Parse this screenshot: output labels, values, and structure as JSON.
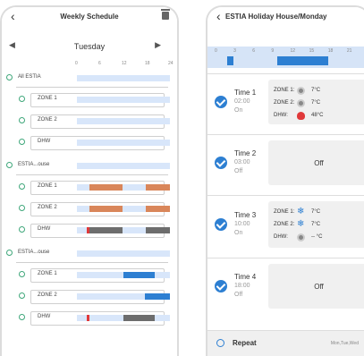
{
  "left": {
    "title": "Weekly Schedule",
    "day": "Tuesday",
    "ticks": [
      "0",
      "6",
      "12",
      "18",
      "24"
    ],
    "colors": {
      "orange": "#d9865a",
      "blue": "#2d7fd2",
      "gray": "#6d6d6d",
      "red": "#e0393a",
      "light": "#d8e6fa",
      "green": "#3fa77a"
    },
    "groups": [
      {
        "label": "All ESTIA",
        "rows": [
          {
            "label": "ZONE 1",
            "segments": []
          },
          {
            "label": "ZONE 2",
            "segments": []
          },
          {
            "label": "DHW",
            "segments": []
          }
        ]
      },
      {
        "label": "ESTIA...ouse",
        "rows": [
          {
            "label": "ZONE 1",
            "segments": [
              {
                "start": 3.2,
                "end": 11.8,
                "color": "orange"
              },
              {
                "start": 17.8,
                "end": 24,
                "color": "orange"
              }
            ]
          },
          {
            "label": "ZONE 2",
            "segments": [
              {
                "start": 3.2,
                "end": 11.8,
                "color": "orange"
              },
              {
                "start": 17.8,
                "end": 24,
                "color": "orange"
              }
            ]
          },
          {
            "label": "DHW",
            "segments": [
              {
                "start": 2.5,
                "end": 3.2,
                "color": "red"
              },
              {
                "start": 3.2,
                "end": 11.8,
                "color": "gray"
              },
              {
                "start": 17.8,
                "end": 24,
                "color": "gray"
              }
            ]
          }
        ]
      },
      {
        "label": "ESTIA...ouse",
        "rows": [
          {
            "label": "ZONE 1",
            "segments": [
              {
                "start": 12,
                "end": 20,
                "color": "blue"
              }
            ]
          },
          {
            "label": "ZONE 2",
            "segments": [
              {
                "start": 17.5,
                "end": 24,
                "color": "blue"
              }
            ]
          },
          {
            "label": "DHW",
            "segments": [
              {
                "start": 2.5,
                "end": 3.2,
                "color": "red"
              },
              {
                "start": 3.2,
                "end": 6,
                "color": "light"
              },
              {
                "start": 12,
                "end": 20,
                "color": "gray"
              }
            ]
          }
        ]
      }
    ]
  },
  "right": {
    "title": "ESTIA Holiday House/Monday",
    "ticks": [
      "0",
      "3",
      "6",
      "9",
      "12",
      "15",
      "18",
      "21"
    ],
    "strip": {
      "blocks": [
        {
          "start": 2,
          "end": 3,
          "color": "blue"
        },
        {
          "start": 10,
          "end": 18,
          "color": "blue"
        }
      ]
    },
    "times": [
      {
        "label": "Time 1",
        "time": "02:00",
        "state": "On",
        "details": [
          {
            "name": "ZONE 1:",
            "icon": "gray-circle-icon",
            "value": "7°C"
          },
          {
            "name": "ZONE 2:",
            "icon": "gray-circle-icon",
            "value": "7°C"
          },
          {
            "name": "DHW:",
            "icon": "flame-icon",
            "value": "48°C"
          }
        ]
      },
      {
        "label": "Time 2",
        "time": "03:00",
        "state": "Off",
        "off_text": "Off"
      },
      {
        "label": "Time 3",
        "time": "10:00",
        "state": "On",
        "details": [
          {
            "name": "ZONE 1:",
            "icon": "snowflake-icon",
            "value": "7°C"
          },
          {
            "name": "ZONE 2:",
            "icon": "snowflake-icon",
            "value": "7°C"
          },
          {
            "name": "DHW:",
            "icon": "gray-circle-icon",
            "value": "-- °C"
          }
        ]
      },
      {
        "label": "Time 4",
        "time": "18:00",
        "state": "Off",
        "off_text": "Off"
      }
    ],
    "repeat_label": "Repeat",
    "repeat_days": "Mon,Tue,Wed"
  }
}
